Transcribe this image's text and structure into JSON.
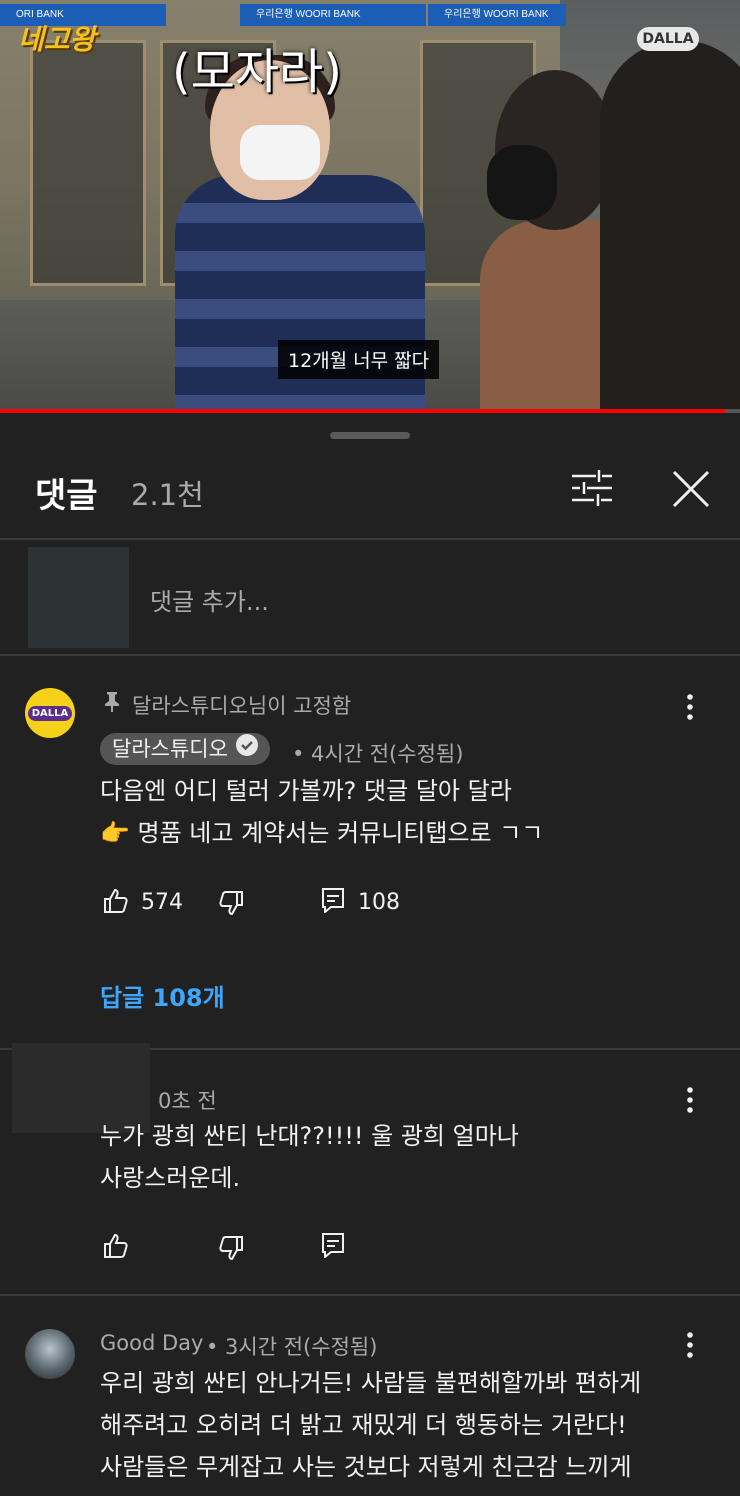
{
  "video": {
    "overlay_caption": "(모자라)",
    "subtitle": "12개월 너무 짧다",
    "channel_logo_text": "네고왕",
    "watermark_text": "DALLA",
    "bank_sign_1": "ORI BANK",
    "bank_sign_2": "우리은행 WOORI BANK",
    "bank_sign_3": "우리은행 WOORI BANK",
    "progress_fraction": 0.98
  },
  "comments_panel": {
    "title": "댓글",
    "count": "2.1천",
    "add_comment_placeholder": "댓글 추가...",
    "icons": {
      "sort": "sort-icon",
      "close": "close-icon"
    }
  },
  "comments": [
    {
      "pinned_text": "달라스튜디오님이 고정함",
      "author": "달라스튜디오",
      "verified": true,
      "time": "• 4시간 전(수정됨)",
      "line1": "다음엔 어디 털러 가볼까? 댓글 달아 달라",
      "line2": "👉 명품 네고 계약서는 커뮤니티탭으로 ㄱㄱ",
      "likes": "574",
      "reply_count": "108",
      "replies_link": "답글 108개",
      "avatar_text": "DALLA",
      "avatar_color": "#f5d118"
    },
    {
      "author": "",
      "time": "0초 전",
      "line1": "누가 광희 싼티 난대??!!!! 울 광희 얼마나",
      "line2": "사랑스러운데."
    },
    {
      "author": "Good Day",
      "time": " • 3시간 전(수정됨)",
      "line1": "우리 광희 싼티 안나거든! 사람들 불편해할까봐 편하게",
      "line2": "해주려고 오히려 더 밝고 재밌게 더 행동하는 거란다!",
      "line3": "사람들은 무게잡고 사는 것보다 저렇게 친근감 느끼게"
    }
  ],
  "colors": {
    "background": "#212121",
    "link": "#3ea6ff",
    "progress": "#ff0000",
    "secondary_text": "#aaaaaa"
  }
}
